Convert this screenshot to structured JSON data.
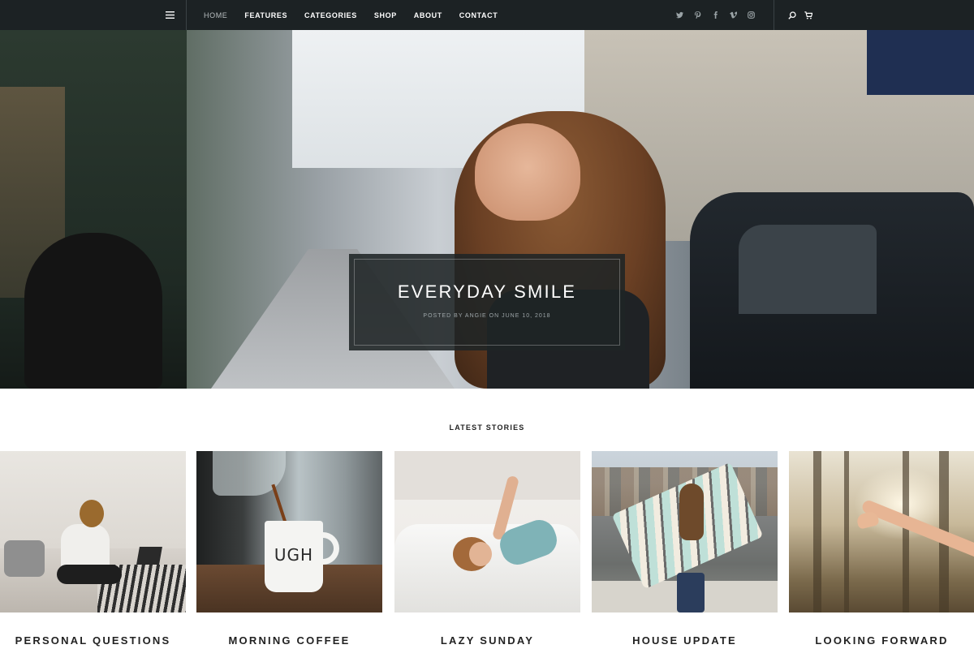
{
  "nav": {
    "menu_icon": "hamburger-icon",
    "links": [
      "HOME",
      "FEATURES",
      "CATEGORIES",
      "SHOP",
      "ABOUT",
      "CONTACT"
    ],
    "active_link": "HOME",
    "social_icons": [
      "twitter-icon",
      "pinterest-icon",
      "facebook-icon",
      "vimeo-icon",
      "instagram-icon"
    ],
    "tool_icons": [
      "search-icon",
      "cart-icon"
    ]
  },
  "hero": {
    "title": "EVERYDAY SMILE",
    "meta": "POSTED BY ANGIE ON JUNE 10, 2018"
  },
  "latest": {
    "heading": "LATEST STORIES",
    "stories": [
      {
        "title": "PERSONAL QUESTIONS"
      },
      {
        "title": "MORNING COFFEE"
      },
      {
        "title": "LAZY SUNDAY"
      },
      {
        "title": "HOUSE UPDATE"
      },
      {
        "title": "LOOKING FORWARD"
      }
    ]
  },
  "mug_text": "UGH",
  "colors": {
    "nav_bg": "#1c2224",
    "caption_bg": "#1f2426",
    "text_dark": "#222222"
  }
}
